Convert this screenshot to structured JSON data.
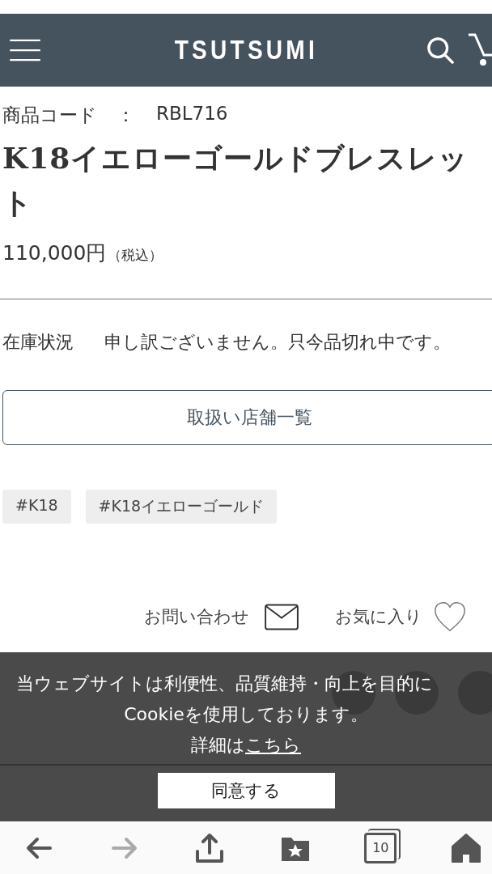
{
  "header": {
    "logo": "TSUTSUMI"
  },
  "product": {
    "code_label": "商品コード",
    "code_sep": "：",
    "code": "RBL716",
    "title": "K18イエローゴールドブレスレット",
    "price": "110,000円",
    "tax_note": "（税込）",
    "stock_label": "在庫状況",
    "stock_status": "申し訳ございません。只今品切れ中です。",
    "stores_button": "取扱い店舗一覧",
    "tags": [
      "#K18",
      "#K18イエローゴールド"
    ]
  },
  "actions": {
    "contact": "お問い合わせ",
    "favorite": "お気に入り"
  },
  "cookie_banner": {
    "lines": [
      "当ウェブサイトは利便性、品質維持・向上を目的に",
      "Cookieを使用しております。"
    ],
    "detail_prefix": "詳細は",
    "detail_link": "こちら",
    "agree_button": "同意する"
  },
  "browser_bar": {
    "forward_disabled": true,
    "tab_count": "10"
  }
}
